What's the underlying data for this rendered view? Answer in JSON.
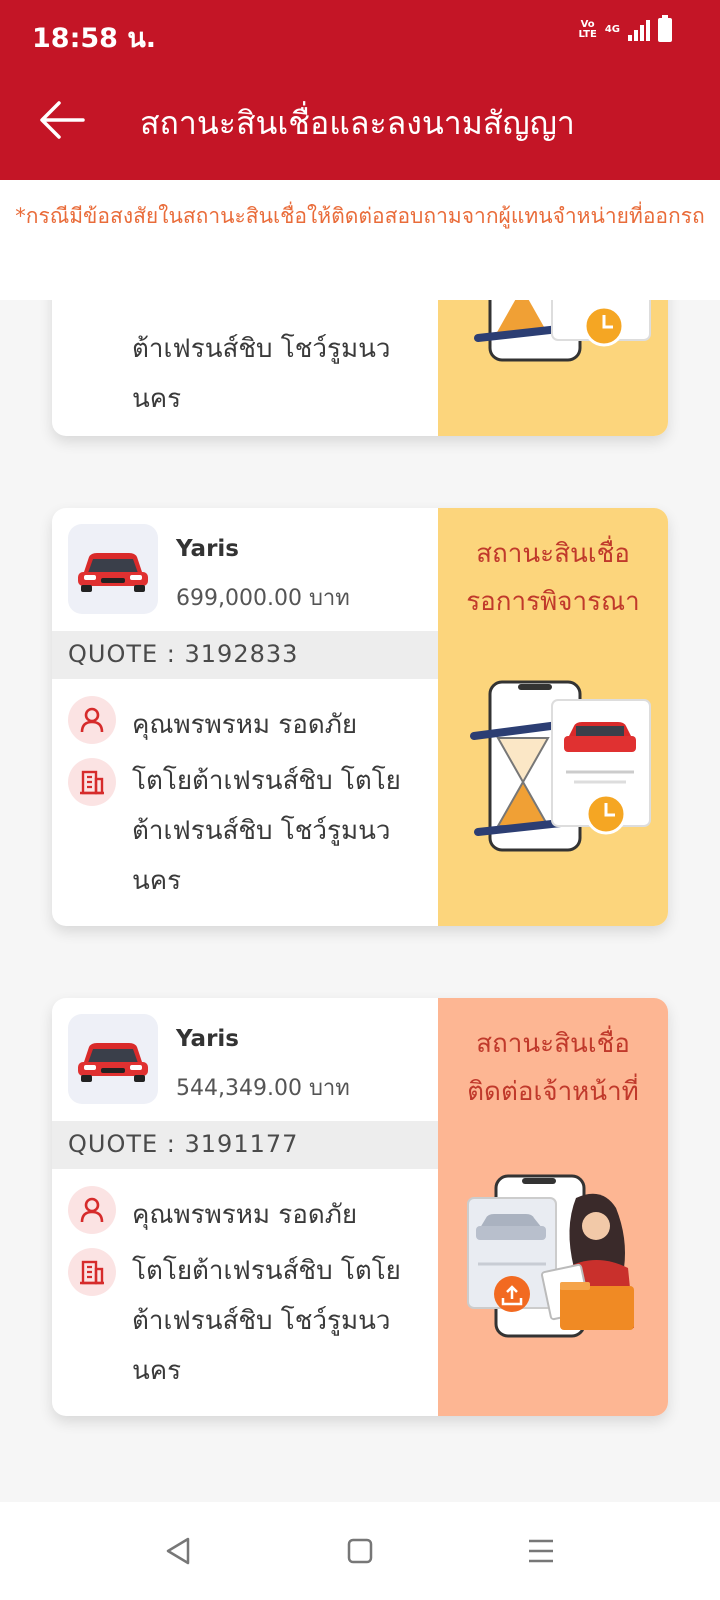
{
  "status_bar": {
    "time": "18:58 น.",
    "network": "4G",
    "volte": "Vo LTE"
  },
  "header": {
    "title": "สถานะสินเชื่อและลงนามสัญญา"
  },
  "notice": "*กรณีมีข้อสงสัยในสถานะสินเชื่อให้ติดต่อสอบถามจากผู้แทนจำหน่ายที่ออกรถ",
  "cards": [
    {
      "dealer": "โตโยต้าเฟรนส์ชิบ โตโยต้าเฟรนส์ชิบ โชว์รูมนวนคร",
      "dealer_visible_lines": [
        "ต้าเฟรนส์ชิบ โชว์รูมนว",
        "นคร"
      ],
      "status_color": "#fcd57c"
    },
    {
      "model": "Yaris",
      "price": "699,000.00 บาท",
      "quote": "QUOTE : 3192833",
      "customer": "คุณพรพรหม รอดภัย",
      "dealer_lines": [
        "โตโยต้าเฟรนส์ชิบ โตโย",
        "ต้าเฟรนส์ชิบ โชว์รูมนว",
        "นคร"
      ],
      "status_line1": "สถานะสินเชื่อ",
      "status_line2": "รอการพิจารณา",
      "status_color": "#fcd57c"
    },
    {
      "model": "Yaris",
      "price": "544,349.00 บาท",
      "quote": "QUOTE : 3191177",
      "customer": "คุณพรพรหม รอดภัย",
      "dealer_lines": [
        "โตโยต้าเฟรนส์ชิบ โตโย",
        "ต้าเฟรนส์ชิบ โชว์รูมนว",
        "นคร"
      ],
      "status_line1": "สถานะสินเชื่อ",
      "status_line2": "ติดต่อเจ้าหน้าที่",
      "status_color": "#fdb693"
    }
  ],
  "colors": {
    "brand_red": "#c41526",
    "notice_orange": "#e96c3a",
    "status_text": "#c0392b"
  },
  "icons": [
    "back-arrow-icon",
    "car-icon",
    "person-icon",
    "building-icon",
    "hourglass-phone-illustration",
    "agent-documents-illustration",
    "nav-back-icon",
    "nav-home-icon",
    "nav-menu-icon"
  ]
}
